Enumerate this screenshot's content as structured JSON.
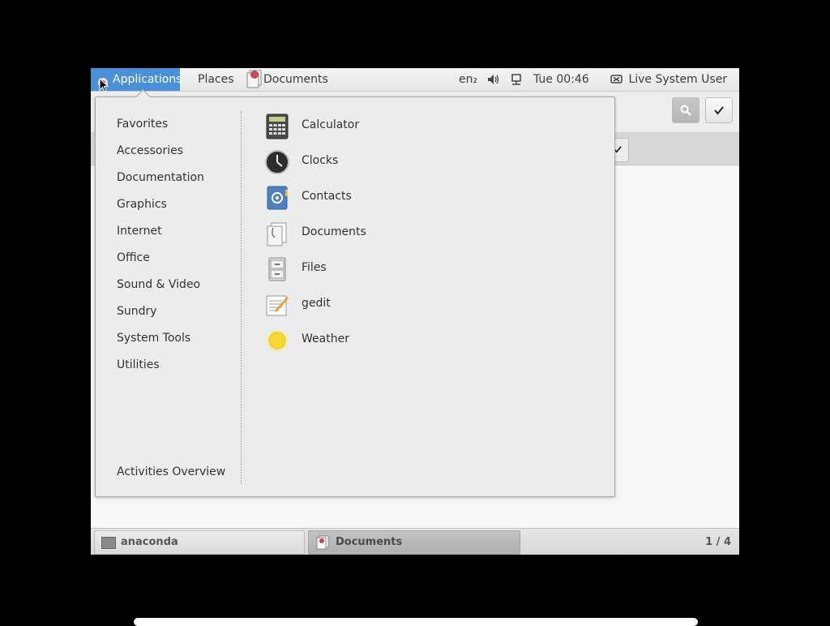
{
  "top_panel": {
    "applications_label": "Applications",
    "places_label": "Places",
    "focused_app_label": "Documents",
    "keyboard_layout": "en₂",
    "clock": "Tue 00:46",
    "user": "Live System User"
  },
  "categories": [
    "Favorites",
    "Accessories",
    "Documentation",
    "Graphics",
    "Internet",
    "Office",
    "Sound & Video",
    "Sundry",
    "System Tools",
    "Utilities"
  ],
  "activities_label": "Activities Overview",
  "apps": [
    {
      "label": "Calculator",
      "icon": "calculator-icon"
    },
    {
      "label": "Clocks",
      "icon": "clock-icon"
    },
    {
      "label": "Contacts",
      "icon": "contacts-icon"
    },
    {
      "label": "Documents",
      "icon": "documents-icon"
    },
    {
      "label": "Files",
      "icon": "file-cabinet-icon"
    },
    {
      "label": "gedit",
      "icon": "text-editor-icon"
    },
    {
      "label": "Weather",
      "icon": "weather-sun-icon"
    }
  ],
  "taskbar": {
    "tasks": [
      {
        "label": "anaconda"
      },
      {
        "label": "Documents"
      }
    ],
    "workspace": "1 / 4"
  },
  "colors": {
    "accent": "#4a90d9"
  }
}
